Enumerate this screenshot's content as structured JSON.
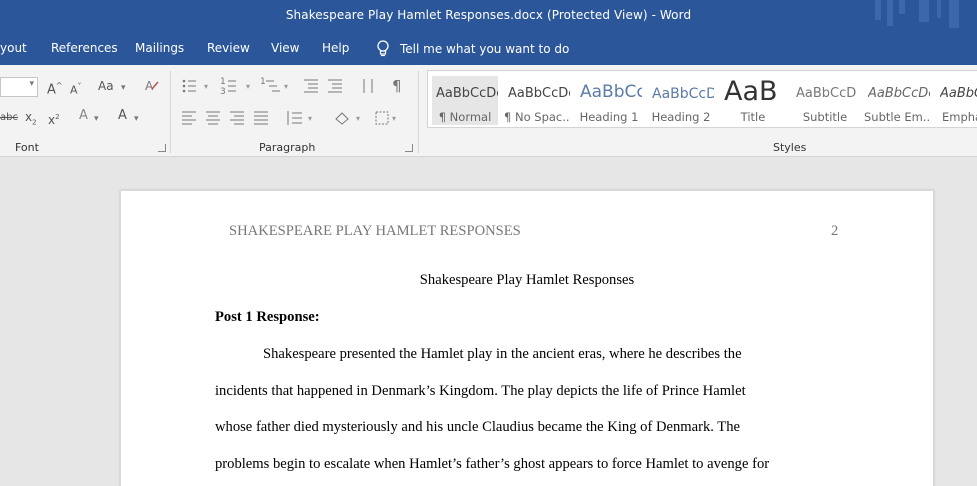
{
  "window": {
    "title": "Shakespeare Play Hamlet Responses.docx (Protected View)  -  Word"
  },
  "menu": {
    "items": [
      "yout",
      "References",
      "Mailings",
      "Review",
      "View",
      "Help"
    ],
    "tell_me": "Tell me what you want to do"
  },
  "ribbon": {
    "groups": {
      "font": "Font",
      "paragraph": "Paragraph",
      "styles": "Styles"
    },
    "font_tools": {
      "grow": "A",
      "shrink": "A",
      "case": "Aa",
      "strike": "abc",
      "subscript": "x",
      "superscript": "x",
      "effects": "A",
      "color": "A"
    },
    "styles": [
      {
        "sample": "AaBbCcDc",
        "name": "¶ Normal"
      },
      {
        "sample": "AaBbCcDc",
        "name": "¶ No Spac..."
      },
      {
        "sample": "AaBbCc",
        "name": "Heading 1"
      },
      {
        "sample": "AaBbCcD",
        "name": "Heading 2"
      },
      {
        "sample": "AaB",
        "name": "Title"
      },
      {
        "sample": "AaBbCcD",
        "name": "Subtitle"
      },
      {
        "sample": "AaBbCcDc",
        "name": "Subtle Em..."
      },
      {
        "sample": "AaBbCcDc",
        "name": "Empha"
      }
    ]
  },
  "document": {
    "running_head": "SHAKESPEARE PLAY HAMLET RESPONSES",
    "page_number": "2",
    "title": "Shakespeare Play Hamlet Responses",
    "section_heading": "Post 1 Response:",
    "lines": [
      "Shakespeare presented the Hamlet play in the ancient eras, where he describes the",
      "incidents that happened in Denmark’s Kingdom. The play depicts the life of Prince Hamlet",
      "whose father died mysteriously and his uncle Claudius became the King of Denmark. The",
      "problems begin to escalate when Hamlet’s father’s ghost appears to force Hamlet to avenge for"
    ]
  },
  "colors": {
    "accent": "#2b579a",
    "ribbon_bg": "#f3f3f3",
    "doc_bg": "#e6e6e6"
  }
}
